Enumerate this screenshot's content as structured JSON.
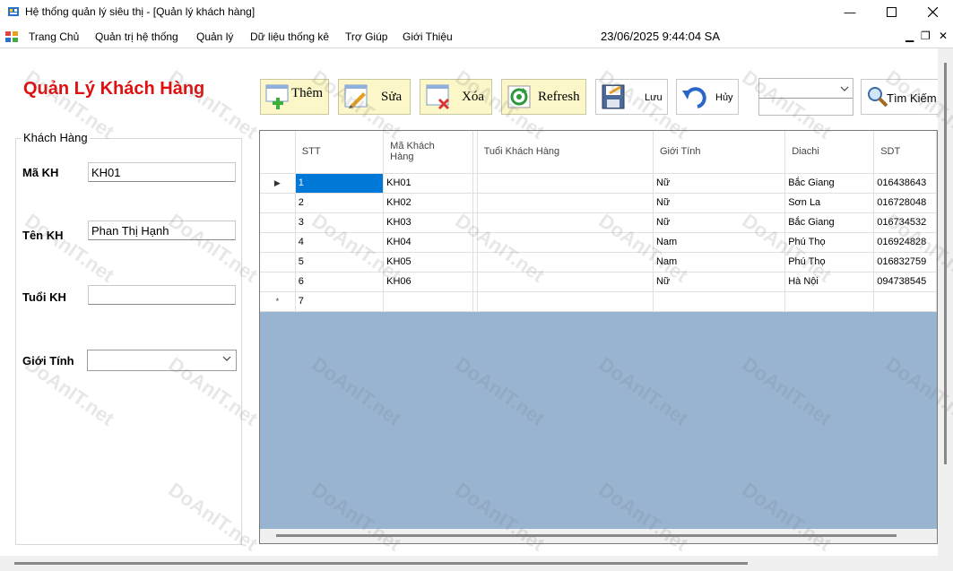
{
  "window": {
    "title": "Hệ thống quản lý siêu thị - [Quản lý khách hàng]"
  },
  "menu": {
    "items": [
      "Trang Chủ",
      "Quản trị hệ thống",
      "Quản lý",
      "Dữ liệu thống kê",
      "Trợ Giúp",
      "Giới Thiệu"
    ],
    "clock": "23/06/2025 9:44:04 SA"
  },
  "page": {
    "title": "Quản Lý Khách Hàng"
  },
  "form": {
    "group_title": "Khách Hàng",
    "ma_kh_label": "Mã KH",
    "ma_kh_value": "KH01",
    "ten_kh_label": "Tên KH",
    "ten_kh_value": "Phan Thị Hạnh",
    "tuoi_kh_label": "Tuổi KH",
    "tuoi_kh_value": "",
    "gioi_tinh_label": "Giới Tính",
    "gioi_tinh_value": ""
  },
  "toolbar": {
    "them": "Thêm",
    "sua": "Sửa",
    "xoa": "Xóa",
    "refresh": "Refresh",
    "luu": "Lưu",
    "huy": "Hủy",
    "tim_kiem": "Tìm Kiếm",
    "search_value": ""
  },
  "grid": {
    "columns": [
      "STT",
      "Mã Khách Hàng",
      "Tuổi Khách Hàng",
      "Giới Tính",
      "Diachi",
      "SDT"
    ],
    "rows": [
      [
        "1",
        "KH01",
        "",
        "Nữ",
        "Bắc Giang",
        "016438643"
      ],
      [
        "2",
        "KH02",
        "",
        "Nữ",
        "Sơn La",
        "016728048"
      ],
      [
        "3",
        "KH03",
        "",
        "Nữ",
        "Bắc Giang",
        "016734532"
      ],
      [
        "4",
        "KH04",
        "",
        "Nam",
        "Phú Thọ",
        "016924828"
      ],
      [
        "5",
        "KH05",
        "",
        "Nam",
        "Phú Thọ",
        "016832759"
      ],
      [
        "6",
        "KH06",
        "",
        "Nữ",
        "Hà Nội",
        "094738545"
      ],
      [
        "7",
        "",
        "",
        "",
        "",
        ""
      ]
    ],
    "row_header_glyphs": [
      "▶",
      "",
      "",
      "",
      "",
      "",
      "*"
    ]
  },
  "watermark": "DoAnIT.net",
  "colors": {
    "title_red": "#e01010",
    "grid_bg": "#99b4d1",
    "selection": "#0078d7",
    "button_yellow": "#fbf7c8"
  }
}
